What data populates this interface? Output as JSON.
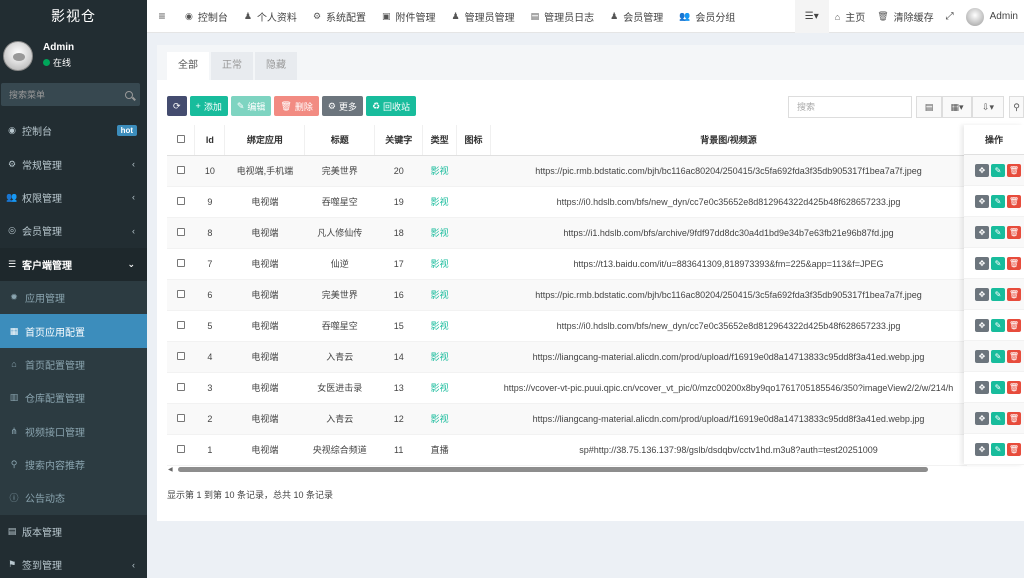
{
  "sidebar": {
    "logo": "影视仓",
    "user": {
      "name": "Admin",
      "status": "在线"
    },
    "search_placeholder": "搜索菜单",
    "items": [
      {
        "label": "控制台",
        "icon": "dashboard-icon",
        "glyph": "◉",
        "badge": "hot"
      },
      {
        "label": "常规管理",
        "icon": "cogs-icon",
        "glyph": "⚙",
        "chevron": "‹"
      },
      {
        "label": "权限管理",
        "icon": "users-icon",
        "glyph": "👥",
        "chevron": "‹"
      },
      {
        "label": "会员管理",
        "icon": "user-circle-icon",
        "glyph": "◎",
        "chevron": "‹"
      },
      {
        "label": "客户端管理",
        "icon": "list-icon",
        "glyph": "☰",
        "chevron": "⌄",
        "open": true
      },
      {
        "label": "应用管理",
        "icon": "gear-icon",
        "glyph": "✹",
        "sub": true
      },
      {
        "label": "首页应用配置",
        "icon": "grid-icon",
        "glyph": "▦",
        "sub": true,
        "active": true
      },
      {
        "label": "首页配置管理",
        "icon": "home-icon",
        "glyph": "⌂",
        "sub": true
      },
      {
        "label": "仓库配置管理",
        "icon": "bank-icon",
        "glyph": "▥",
        "sub": true
      },
      {
        "label": "视频接口管理",
        "icon": "sitemap-icon",
        "glyph": "⋔",
        "sub": true
      },
      {
        "label": "搜索内容推荐",
        "icon": "search-icon",
        "glyph": "⚲",
        "sub": true
      },
      {
        "label": "公告动态",
        "icon": "info-icon",
        "glyph": "ⓘ",
        "sub": true
      },
      {
        "label": "版本管理",
        "icon": "file-icon",
        "glyph": "▤"
      },
      {
        "label": "签到管理",
        "icon": "map-marker-icon",
        "glyph": "⚑",
        "chevron": "‹"
      }
    ]
  },
  "navbar": {
    "toggle_glyph": "≡",
    "items": [
      {
        "label": "控制台",
        "icon": "dashboard-icon",
        "glyph": "◉"
      },
      {
        "label": "个人资料",
        "icon": "user-icon",
        "glyph": "♟"
      },
      {
        "label": "系统配置",
        "icon": "cog-icon",
        "glyph": "⚙"
      },
      {
        "label": "附件管理",
        "icon": "image-icon",
        "glyph": "▣"
      },
      {
        "label": "管理员管理",
        "icon": "user-icon",
        "glyph": "♟"
      },
      {
        "label": "管理员日志",
        "icon": "list-alt-icon",
        "glyph": "▤"
      },
      {
        "label": "会员管理",
        "icon": "user-icon",
        "glyph": "♟"
      },
      {
        "label": "会员分组",
        "icon": "users-icon",
        "glyph": "👥"
      }
    ],
    "right": {
      "menu_glyph": "☰▾",
      "home": "主页",
      "home_glyph": "⌂",
      "clear_cache": "清除缓存",
      "clear_glyph": "🗑",
      "fullscreen_glyph": "⤢",
      "admin": "Admin"
    }
  },
  "tabs": [
    "全部",
    "正常",
    "隐藏"
  ],
  "toolbar": {
    "refresh_glyph": "⟳",
    "add": "添加",
    "add_glyph": "+",
    "edit": "编辑",
    "edit_glyph": "✎",
    "delete": "删除",
    "delete_glyph": "🗑",
    "more": "更多",
    "more_glyph": "⚙",
    "recycle": "回收站",
    "recycle_glyph": "♻",
    "search_placeholder": "搜索",
    "tool_print": "▤",
    "tool_columns": "▦▾",
    "tool_export": "⇩▾",
    "tool_search": "⚲"
  },
  "table": {
    "columns": [
      "",
      "Id",
      "绑定应用",
      "标题",
      "关键字",
      "类型",
      "图标",
      "背景图/视频源"
    ],
    "ops_header": "操作",
    "rows": [
      {
        "id": "10",
        "app": "电视端,手机端",
        "title": "完美世界",
        "keyword": "20",
        "type": "影视",
        "src": "https://pic.rmb.bdstatic.com/bjh/bc116ac80204/250415/3c5fa692fda3f35db905317f1bea7a7f.jpeg"
      },
      {
        "id": "9",
        "app": "电视端",
        "title": "吞噬星空",
        "keyword": "19",
        "type": "影视",
        "src": "https://i0.hdslb.com/bfs/new_dyn/cc7e0c35652e8d812964322d425b48f628657233.jpg"
      },
      {
        "id": "8",
        "app": "电视端",
        "title": "凡人修仙传",
        "keyword": "18",
        "type": "影视",
        "src": "https://i1.hdslb.com/bfs/archive/9fdf97dd8dc30a4d1bd9e34b7e63fb21e96b87fd.jpg"
      },
      {
        "id": "7",
        "app": "电视端",
        "title": "仙逆",
        "keyword": "17",
        "type": "影视",
        "src": "https://t13.baidu.com/it/u=883641309,818973393&fm=225&app=113&f=JPEG"
      },
      {
        "id": "6",
        "app": "电视端",
        "title": "完美世界",
        "keyword": "16",
        "type": "影视",
        "src": "https://pic.rmb.bdstatic.com/bjh/bc116ac80204/250415/3c5fa692fda3f35db905317f1bea7a7f.jpeg"
      },
      {
        "id": "5",
        "app": "电视端",
        "title": "吞噬星空",
        "keyword": "15",
        "type": "影视",
        "src": "https://i0.hdslb.com/bfs/new_dyn/cc7e0c35652e8d812964322d425b48f628657233.jpg"
      },
      {
        "id": "4",
        "app": "电视端",
        "title": "入青云",
        "keyword": "14",
        "type": "影视",
        "src": "https://liangcang-material.alicdn.com/prod/upload/f16919e0d8a14713833c95dd8f3a41ed.webp.jpg"
      },
      {
        "id": "3",
        "app": "电视端",
        "title": "女医进击录",
        "keyword": "13",
        "type": "影视",
        "src": "https://vcover-vt-pic.puui.qpic.cn/vcover_vt_pic/0/mzc00200x8by9qo1761705185546/350?imageView2/2/w/214/h"
      },
      {
        "id": "2",
        "app": "电视端",
        "title": "入青云",
        "keyword": "12",
        "type": "影视",
        "src": "https://liangcang-material.alicdn.com/prod/upload/f16919e0d8a14713833c95dd8f3a41ed.webp.jpg"
      },
      {
        "id": "1",
        "app": "电视端",
        "title": "央视综合频道",
        "keyword": "11",
        "type": "直播",
        "src": "sp#http://38.75.136.137:98/gslb/dsdqbv/cctv1hd.m3u8?auth=test20251009"
      }
    ]
  },
  "pagination_info": "显示第 1 到第 10 条记录，总共 10 条记录",
  "colors": {
    "sidebar_bg": "#222d32",
    "active_blue": "#3c8dbc",
    "accent_green": "#18bc9c",
    "danger_red": "#e74c3c"
  }
}
